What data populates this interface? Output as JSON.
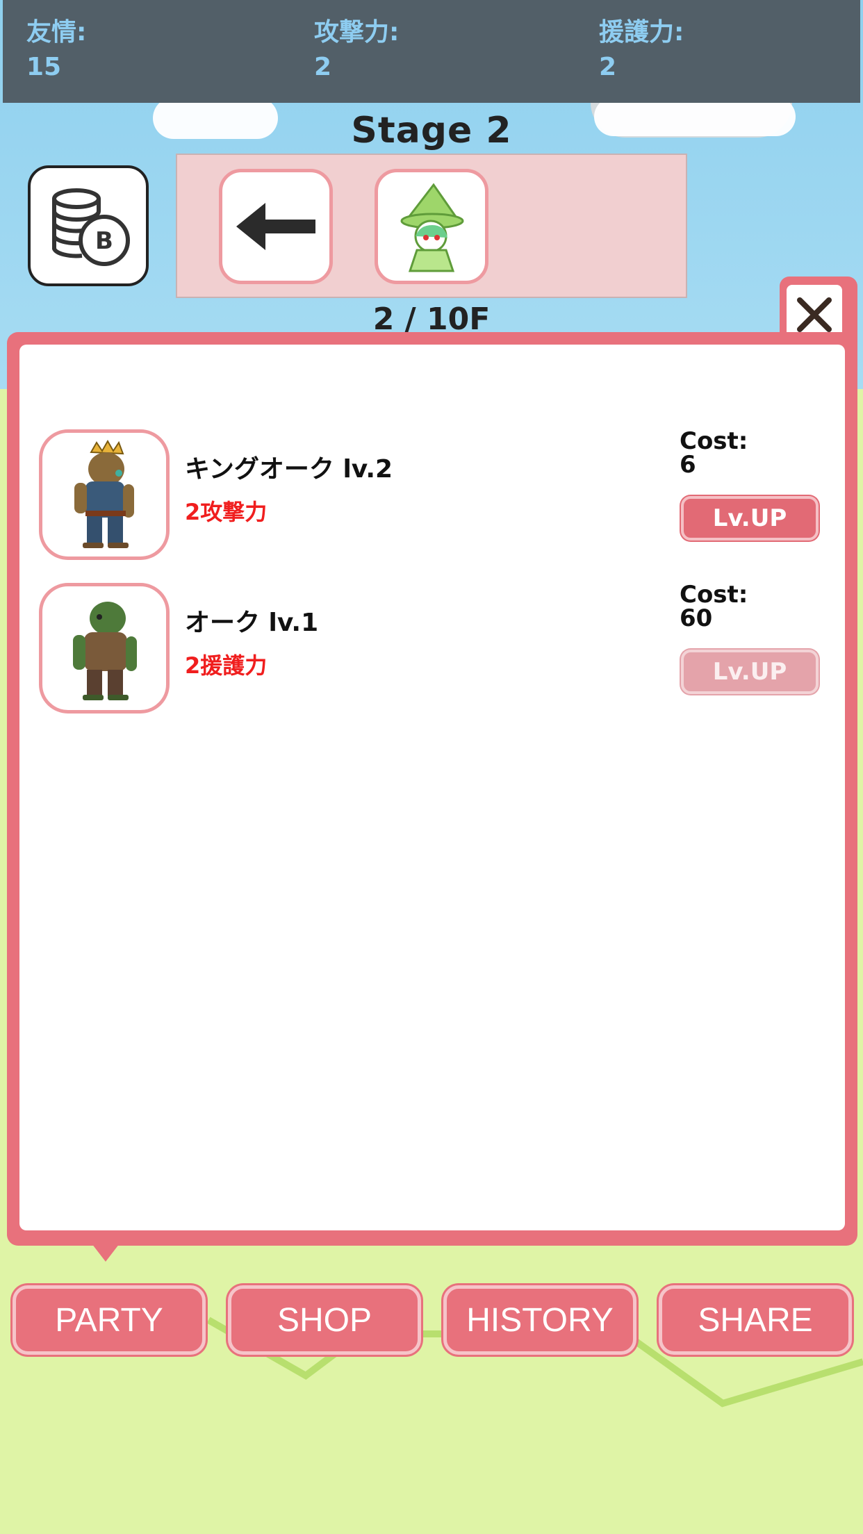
{
  "stats": [
    {
      "label": "友情:",
      "value": "15"
    },
    {
      "label": "攻撃力:",
      "value": "2"
    },
    {
      "label": "援護力:",
      "value": "2"
    }
  ],
  "stage": {
    "title": "Stage 2",
    "progress": "2 / 10F"
  },
  "icons": {
    "coins": "coin-stack-icon",
    "back": "arrow-left-icon",
    "witch": "green-witch-portrait",
    "close": "close-icon"
  },
  "units": [
    {
      "name": "キングオーク lv.2",
      "stat": "2攻撃力",
      "cost_label": "Cost:",
      "cost": "6",
      "button": "Lv.UP",
      "enabled": true
    },
    {
      "name": "オーク lv.1",
      "stat": "2援護力",
      "cost_label": "Cost:",
      "cost": "60",
      "button": "Lv.UP",
      "enabled": false
    }
  ],
  "tabs": [
    "PARTY",
    "SHOP",
    "HISTORY",
    "SHARE"
  ],
  "colors": {
    "accent": "#e8717c",
    "stat_text": "#8ecdf1",
    "stat_bar": "#525f68",
    "bonus_text": "#f01e1e"
  }
}
